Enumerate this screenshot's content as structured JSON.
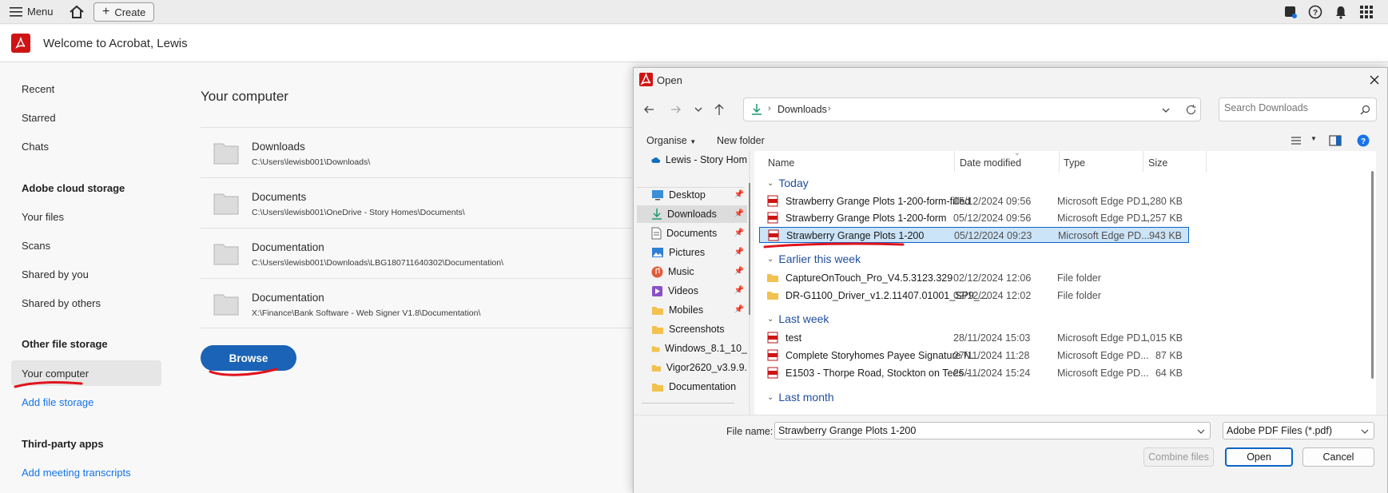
{
  "topbar": {
    "menu_label": "Menu",
    "create_label": "Create"
  },
  "header": {
    "welcome": "Welcome to Acrobat, Lewis"
  },
  "sidebar": {
    "items_top": [
      "Recent",
      "Starred",
      "Chats"
    ],
    "cloud_heading": "Adobe cloud storage",
    "cloud_items": [
      "Your files",
      "Scans",
      "Shared by you",
      "Shared by others"
    ],
    "other_heading": "Other file storage",
    "selected_item": "Your computer",
    "add_storage": "Add file storage",
    "third_heading": "Third-party apps",
    "add_transcripts": "Add meeting transcripts"
  },
  "main": {
    "title": "Your computer",
    "locations": [
      {
        "name": "Downloads",
        "path": "C:\\Users\\lewisb001\\Downloads\\"
      },
      {
        "name": "Documents",
        "path": "C:\\Users\\lewisb001\\OneDrive - Story Homes\\Documents\\"
      },
      {
        "name": "Documentation",
        "path": "C:\\Users\\lewisb001\\Downloads\\LBG180711640302\\Documentation\\"
      },
      {
        "name": "Documentation",
        "path": "X:\\Finance\\Bank Software - Web Signer V1.8\\Documentation\\"
      }
    ],
    "browse_label": "Browse"
  },
  "dialog": {
    "title": "Open",
    "address": "Downloads",
    "search_placeholder": "Search Downloads",
    "organise": "Organise",
    "new_folder": "New folder",
    "left_pane": {
      "onedrive": "Lewis - Story Hom",
      "items": [
        {
          "label": "Desktop",
          "pinned": true
        },
        {
          "label": "Downloads",
          "pinned": true
        },
        {
          "label": "Documents",
          "pinned": true
        },
        {
          "label": "Pictures",
          "pinned": true
        },
        {
          "label": "Music",
          "pinned": true
        },
        {
          "label": "Videos",
          "pinned": true
        },
        {
          "label": "Mobiles",
          "pinned": true
        },
        {
          "label": "Screenshots",
          "pinned": false
        },
        {
          "label": "Windows_8.1_10_",
          "pinned": false
        },
        {
          "label": "Vigor2620_v3.9.9.",
          "pinned": false
        },
        {
          "label": "Documentation",
          "pinned": false
        }
      ]
    },
    "columns": {
      "name": "Name",
      "date": "Date modified",
      "type": "Type",
      "size": "Size"
    },
    "groups": [
      {
        "label": "Today",
        "files": [
          {
            "name": "Strawberry Grange Plots 1-200-form-filled",
            "date": "05/12/2024 09:56",
            "type": "Microsoft Edge PD...",
            "size": "1,280 KB",
            "kind": "pdf"
          },
          {
            "name": "Strawberry Grange Plots 1-200-form",
            "date": "05/12/2024 09:56",
            "type": "Microsoft Edge PD...",
            "size": "1,257 KB",
            "kind": "pdf"
          },
          {
            "name": "Strawberry Grange Plots 1-200",
            "date": "05/12/2024 09:23",
            "type": "Microsoft Edge PD...",
            "size": "943 KB",
            "kind": "pdf",
            "selected": true
          }
        ]
      },
      {
        "label": "Earlier this week",
        "files": [
          {
            "name": "CaptureOnTouch_Pro_V4.5.3123.329",
            "date": "02/12/2024 12:06",
            "type": "File folder",
            "size": "",
            "kind": "folder"
          },
          {
            "name": "DR-G1100_Driver_v1.2.11407.01001_SP9_...",
            "date": "02/12/2024 12:02",
            "type": "File folder",
            "size": "",
            "kind": "folder"
          }
        ]
      },
      {
        "label": "Last week",
        "files": [
          {
            "name": "test",
            "date": "28/11/2024 15:03",
            "type": "Microsoft Edge PD...",
            "size": "1,015 KB",
            "kind": "pdf"
          },
          {
            "name": "Complete Storyhomes Payee Signature N...",
            "date": "27/11/2024 11:28",
            "type": "Microsoft Edge PD...",
            "size": "87 KB",
            "kind": "pdf"
          },
          {
            "name": "E1503 - Thorpe Road, Stockton on Tees - ...",
            "date": "25/11/2024 15:24",
            "type": "Microsoft Edge PD...",
            "size": "64 KB",
            "kind": "pdf"
          }
        ]
      },
      {
        "label": "Last month",
        "files": []
      }
    ],
    "file_name_label": "File name:",
    "file_name_value": "Strawberry Grange Plots 1-200",
    "file_type": "Adobe PDF Files (*.pdf)",
    "combine_label": "Combine files",
    "open_label": "Open",
    "cancel_label": "Cancel"
  },
  "colors": {
    "accent": "#1473e6",
    "browse": "#1a63b6",
    "acrobat_red": "#cf1414",
    "selection": "#cce4f7",
    "annotation": "#e0141e"
  }
}
